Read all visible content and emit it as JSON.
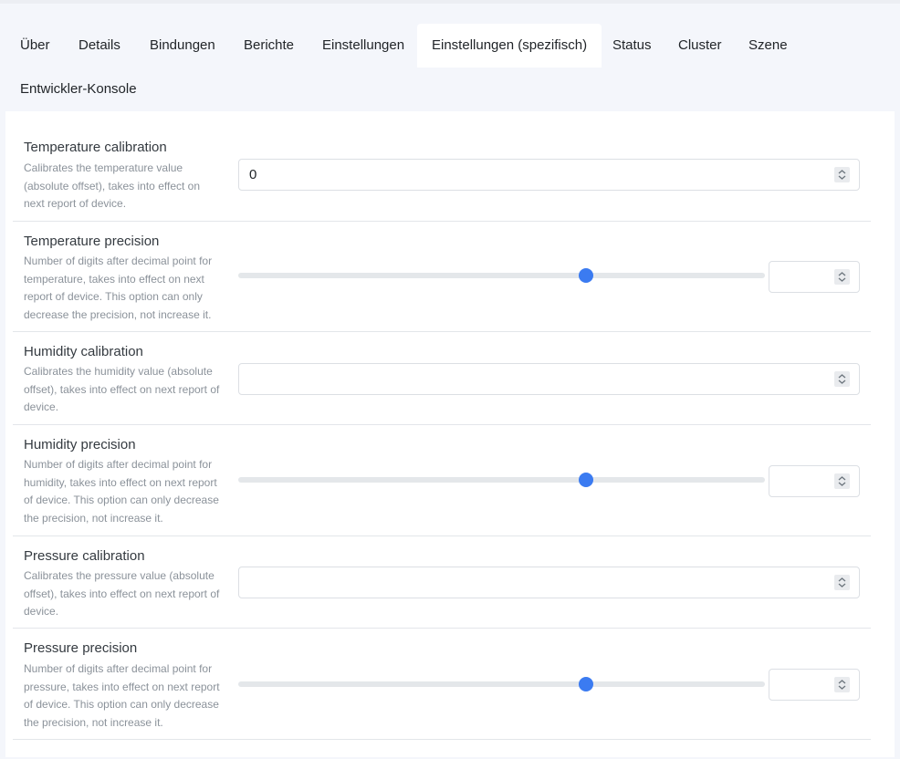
{
  "tabs": [
    {
      "label": "Über",
      "active": false
    },
    {
      "label": "Details",
      "active": false
    },
    {
      "label": "Bindungen",
      "active": false
    },
    {
      "label": "Berichte",
      "active": false
    },
    {
      "label": "Einstellungen",
      "active": false
    },
    {
      "label": "Einstellungen (spezifisch)",
      "active": true
    },
    {
      "label": "Status",
      "active": false
    },
    {
      "label": "Cluster",
      "active": false
    },
    {
      "label": "Szene",
      "active": false
    },
    {
      "label": "Entwickler-Konsole",
      "active": false
    }
  ],
  "settings": [
    {
      "label": "Temperature calibration",
      "description": "Calibrates the temperature value (absolute offset), takes into effect on next report of device.",
      "control": "number",
      "value": "0"
    },
    {
      "label": "Temperature precision",
      "description": "Number of digits after decimal point for temperature, takes into effect on next report of device. This option can only decrease the precision, not increase it.",
      "control": "slider",
      "slider_fraction": 0.66,
      "value": ""
    },
    {
      "label": "Humidity calibration",
      "description": "Calibrates the humidity value (absolute offset), takes into effect on next report of device.",
      "control": "number",
      "value": ""
    },
    {
      "label": "Humidity precision",
      "description": "Number of digits after decimal point for humidity, takes into effect on next report of device. This option can only decrease the precision, not increase it.",
      "control": "slider",
      "slider_fraction": 0.66,
      "value": ""
    },
    {
      "label": "Pressure calibration",
      "description": "Calibrates the pressure value (absolute offset), takes into effect on next report of device.",
      "control": "number",
      "value": ""
    },
    {
      "label": "Pressure precision",
      "description": "Number of digits after decimal point for pressure, takes into effect on next report of device. This option can only decrease the precision, not increase it.",
      "control": "slider",
      "slider_fraction": 0.66,
      "value": ""
    }
  ],
  "colors": {
    "accent": "#3b7bf1",
    "page_background": "#f4f6fb",
    "card_background": "#ffffff"
  },
  "icons": {
    "spinner": "spinner-arrows-icon"
  }
}
